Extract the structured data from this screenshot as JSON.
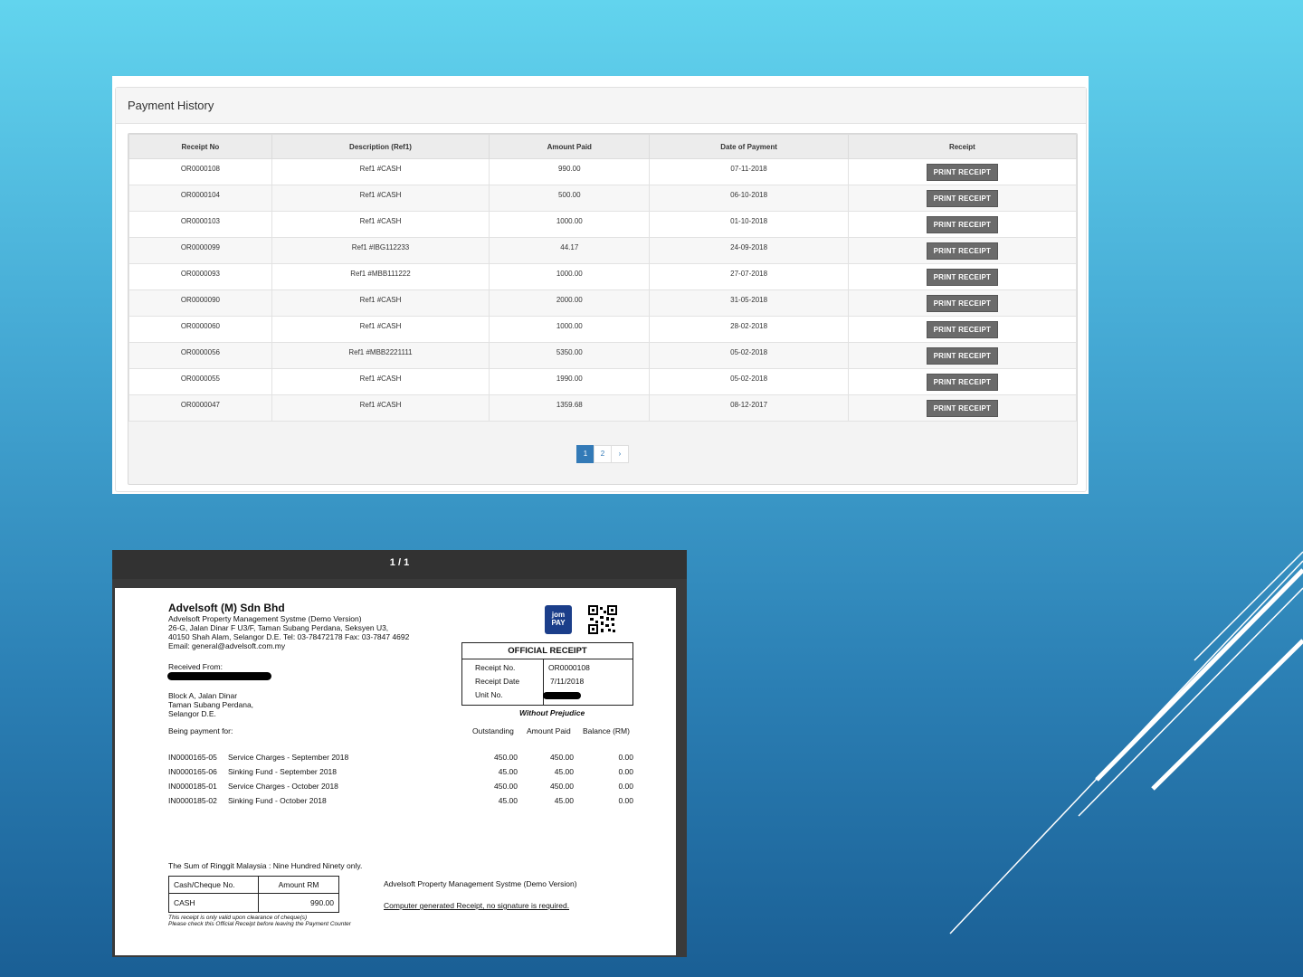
{
  "payment_history": {
    "title": "Payment History",
    "columns": [
      "Receipt No",
      "Description (Ref1)",
      "Amount Paid",
      "Date of Payment",
      "Receipt"
    ],
    "print_label": "PRINT RECEIPT",
    "rows": [
      {
        "receipt_no": "OR0000108",
        "description": "Ref1 #CASH",
        "amount": "990.00",
        "date": "07-11-2018"
      },
      {
        "receipt_no": "OR0000104",
        "description": "Ref1 #CASH",
        "amount": "500.00",
        "date": "06-10-2018"
      },
      {
        "receipt_no": "OR0000103",
        "description": "Ref1 #CASH",
        "amount": "1000.00",
        "date": "01-10-2018"
      },
      {
        "receipt_no": "OR0000099",
        "description": "Ref1 #IBG112233",
        "amount": "44.17",
        "date": "24-09-2018"
      },
      {
        "receipt_no": "OR0000093",
        "description": "Ref1 #MBB111222",
        "amount": "1000.00",
        "date": "27-07-2018"
      },
      {
        "receipt_no": "OR0000090",
        "description": "Ref1 #CASH",
        "amount": "2000.00",
        "date": "31-05-2018"
      },
      {
        "receipt_no": "OR0000060",
        "description": "Ref1 #CASH",
        "amount": "1000.00",
        "date": "28-02-2018"
      },
      {
        "receipt_no": "OR0000056",
        "description": "Ref1 #MBB2221111",
        "amount": "5350.00",
        "date": "05-02-2018"
      },
      {
        "receipt_no": "OR0000055",
        "description": "Ref1 #CASH",
        "amount": "1990.00",
        "date": "05-02-2018"
      },
      {
        "receipt_no": "OR0000047",
        "description": "Ref1 #CASH",
        "amount": "1359.68",
        "date": "08-12-2017"
      }
    ],
    "pagination": {
      "pages": [
        "1",
        "2"
      ],
      "next": "›",
      "active": "1"
    }
  },
  "receipt_viewer": {
    "page_indicator": "1 / 1",
    "company_name": "Advelsoft (M) Sdn Bhd",
    "company_lines": [
      "Advelsoft Property Management Systme (Demo Version)",
      "26-G, Jalan Dinar F  U3/F, Taman Subang Perdana, Seksyen U3,",
      "40150 Shah Alam, Selangor D.E. Tel: 03-78472178    Fax: 03-7847 4692",
      "Email: general@advelsoft.com.my"
    ],
    "jompay_label": "jom PAY",
    "official_receipt": {
      "title": "OFFICIAL RECEIPT",
      "receipt_no_label": "Receipt No.",
      "receipt_no": "OR0000108",
      "receipt_date_label": "Receipt Date",
      "receipt_date": "7/11/2018",
      "unit_label": "Unit No."
    },
    "without_prejudice": "Without Prejudice",
    "received_from_label": "Received From:",
    "address_lines": [
      "Block A, Jalan Dinar",
      "Taman Subang Perdana,",
      "Selangor D.E."
    ],
    "being_payment_for": "Being payment for:",
    "item_headers": [
      "Outstanding",
      "Amount Paid",
      "Balance (RM)"
    ],
    "items": [
      {
        "code": "IN0000165-05",
        "desc": "Service Charges - September 2018",
        "outstanding": "450.00",
        "paid": "450.00",
        "balance": "0.00"
      },
      {
        "code": "IN0000165-06",
        "desc": "Sinking Fund - September 2018",
        "outstanding": "45.00",
        "paid": "45.00",
        "balance": "0.00"
      },
      {
        "code": "IN0000185-01",
        "desc": "Service Charges - October 2018",
        "outstanding": "450.00",
        "paid": "450.00",
        "balance": "0.00"
      },
      {
        "code": "IN0000185-02",
        "desc": "Sinking Fund - October 2018",
        "outstanding": "45.00",
        "paid": "45.00",
        "balance": "0.00"
      }
    ],
    "sum_text": "The Sum of Ringgit Malaysia : Nine Hundred Ninety only.",
    "cash_table": {
      "h1": "Cash/Cheque No.",
      "h2": "Amount  RM",
      "c1": "CASH",
      "c2": "990.00"
    },
    "footer_company": "Advelsoft Property Management Systme (Demo Version)",
    "footer_note": "Computer generated Receipt, no signature is required.",
    "disclaimer_lines": [
      "This receipt is only valid upon clearance of cheque(s)",
      "Please check this Official Receipt before leaving the Payment Counter"
    ]
  }
}
